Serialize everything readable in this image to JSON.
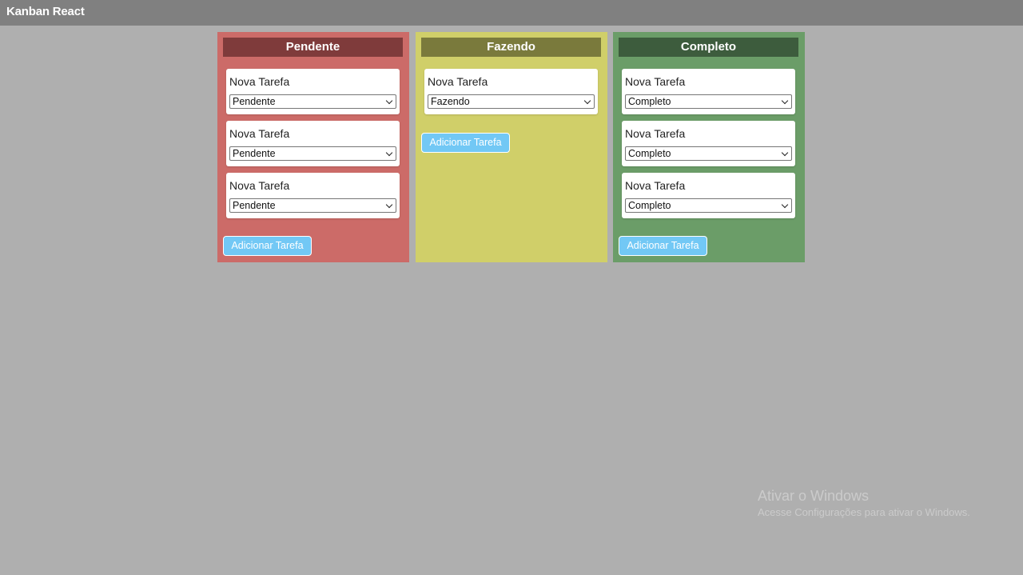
{
  "app": {
    "title": "Kanban React"
  },
  "colors": {
    "page_bg": "#afafaf",
    "topbar_bg": "#808080",
    "button_bg": "#72c8f5"
  },
  "columns": [
    {
      "title": "Pendente",
      "bg": "#cc6b68",
      "header_bg": "#7f3b3b",
      "cards": [
        {
          "title": "Nova Tarefa",
          "status": "Pendente"
        },
        {
          "title": "Nova Tarefa",
          "status": "Pendente"
        },
        {
          "title": "Nova Tarefa",
          "status": "Pendente"
        }
      ],
      "add_label": "Adicionar Tarefa"
    },
    {
      "title": "Fazendo",
      "bg": "#d0cf69",
      "header_bg": "#7a7a3c",
      "cards": [
        {
          "title": "Nova Tarefa",
          "status": "Fazendo"
        }
      ],
      "add_label": "Adicionar Tarefa"
    },
    {
      "title": "Completo",
      "bg": "#6b9d68",
      "header_bg": "#3d5c3d",
      "cards": [
        {
          "title": "Nova Tarefa",
          "status": "Completo"
        },
        {
          "title": "Nova Tarefa",
          "status": "Completo"
        },
        {
          "title": "Nova Tarefa",
          "status": "Completo"
        }
      ],
      "add_label": "Adicionar Tarefa"
    }
  ],
  "watermark": {
    "line1": "Ativar o Windows",
    "line2": "Acesse Configurações para ativar o Windows."
  }
}
